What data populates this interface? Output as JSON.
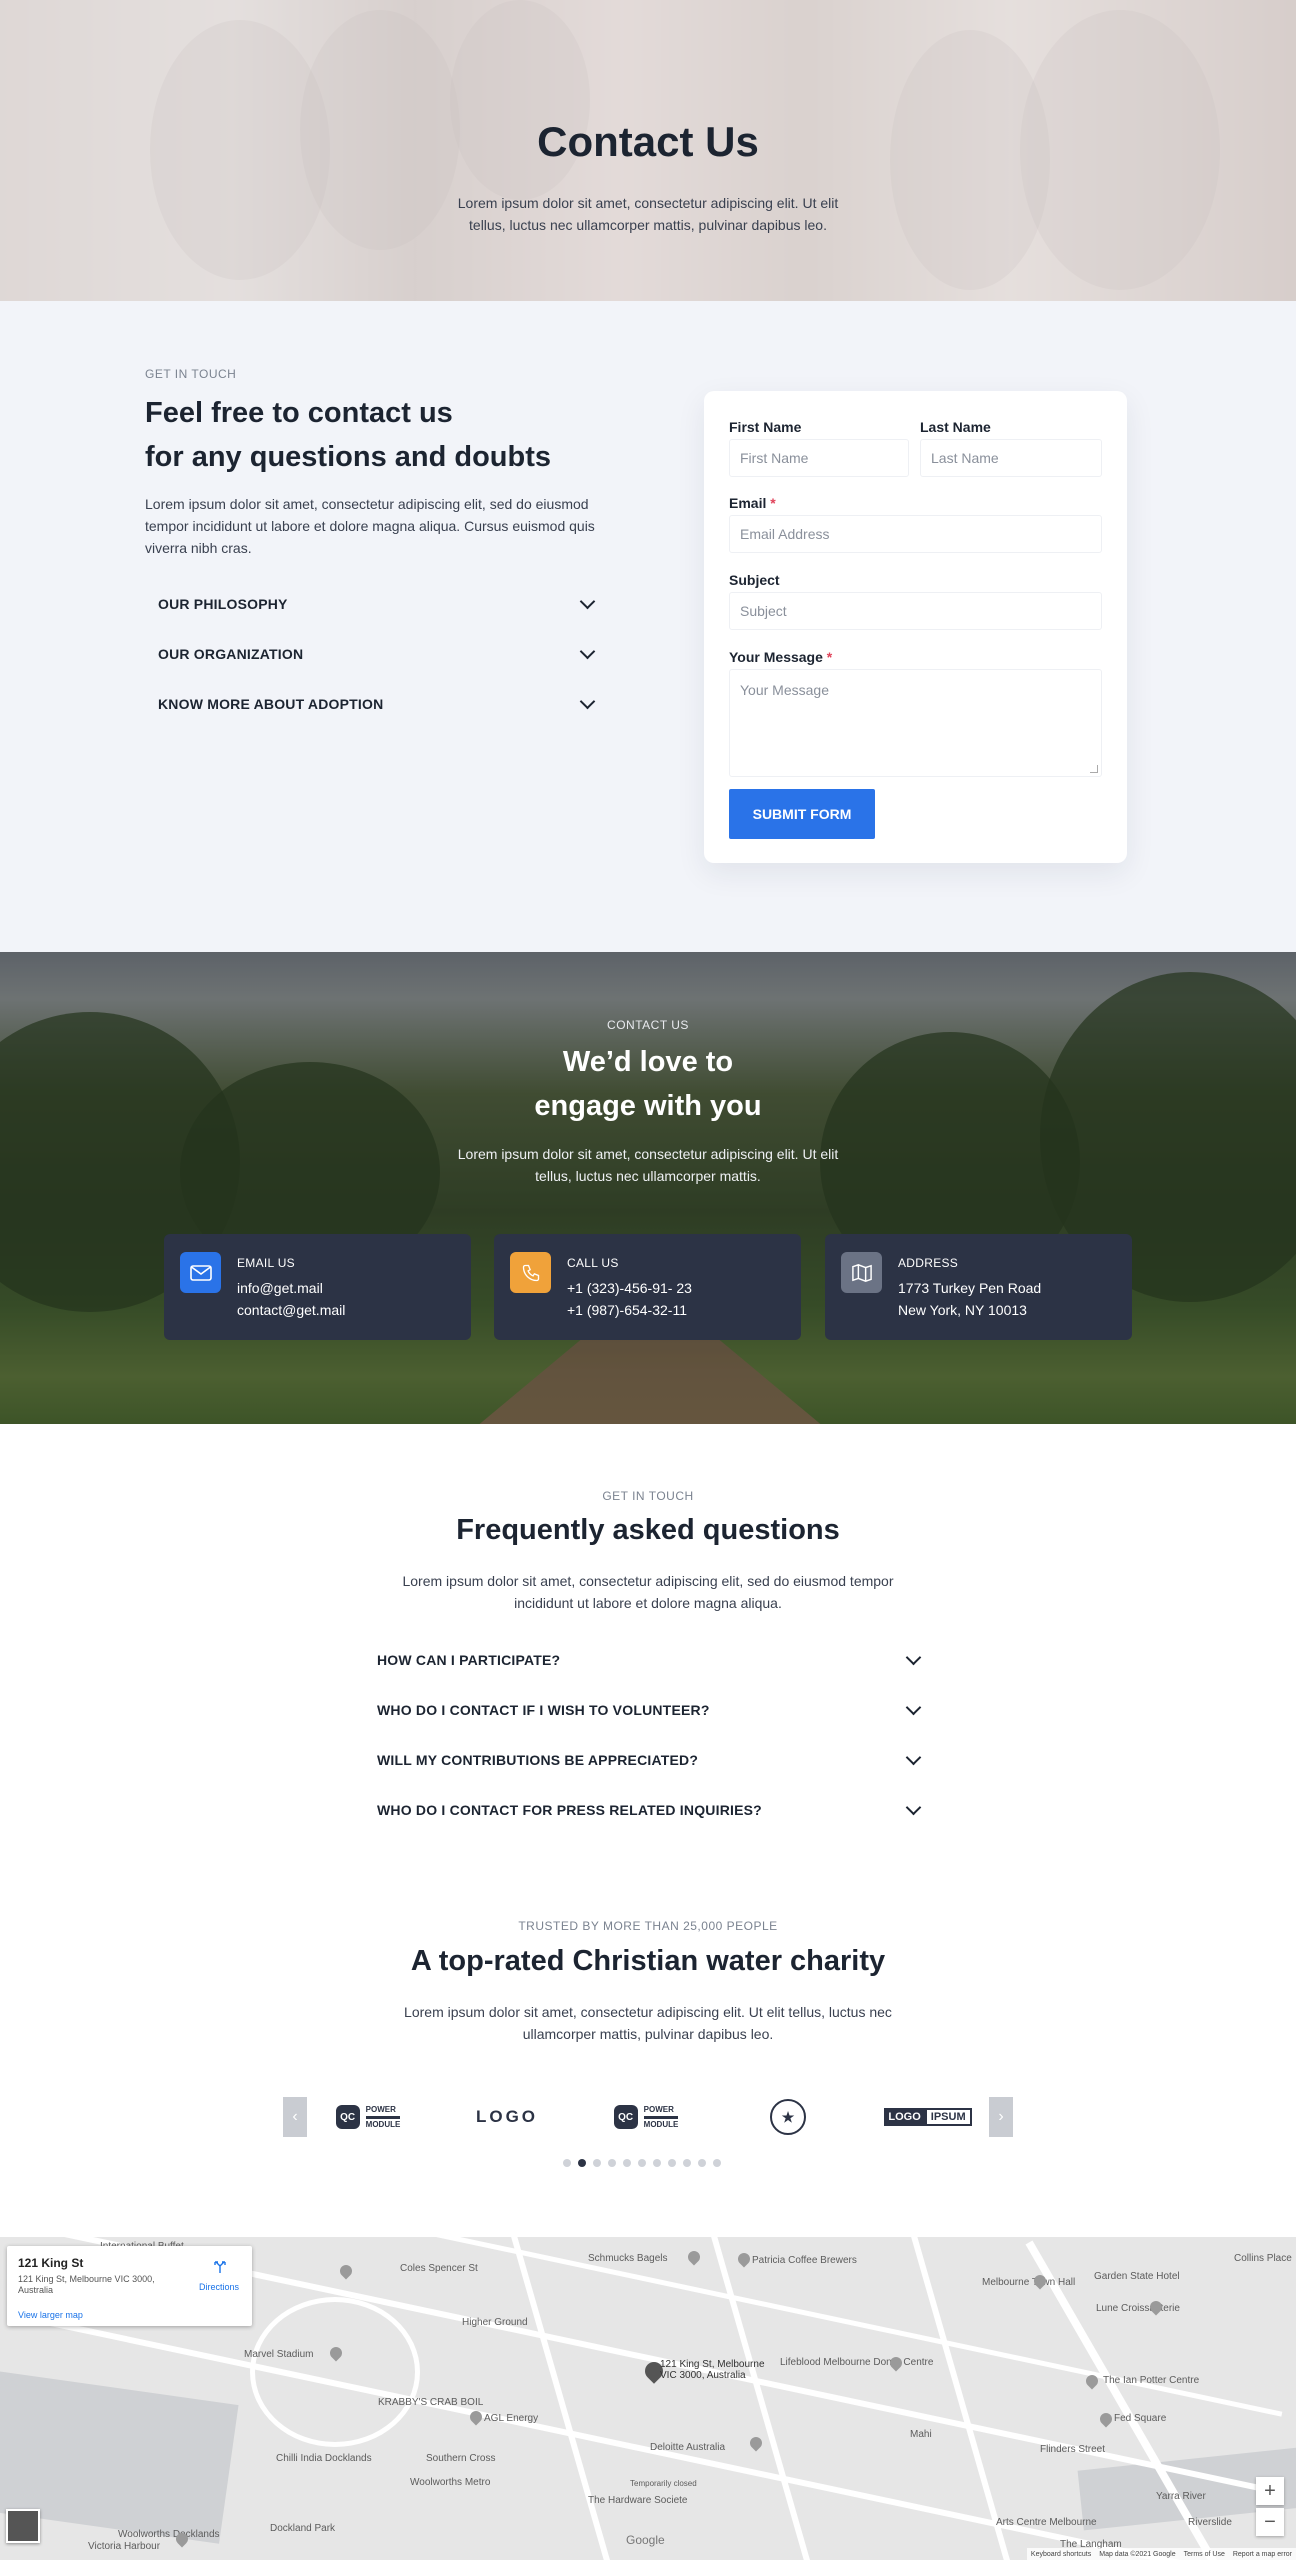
{
  "hero": {
    "title": "Contact Us",
    "subtitle": "Lorem ipsum dolor sit amet, consectetur adipiscing elit. Ut elit tellus, luctus nec ullamcorper mattis, pulvinar dapibus leo."
  },
  "contact": {
    "eyebrow": "GET IN TOUCH",
    "heading_line1": "Feel free to contact us",
    "heading_line2": "for any questions and doubts",
    "intro": "Lorem ipsum dolor sit amet, consectetur adipiscing elit, sed do eiusmod tempor incididunt ut labore et dolore magna aliqua. Cursus euismod quis viverra nibh cras.",
    "accordion": [
      "OUR PHILOSOPHY",
      "OUR ORGANIZATION",
      "KNOW MORE ABOUT ADOPTION"
    ]
  },
  "form": {
    "first_name_label": "First Name",
    "first_name_placeholder": "First Name",
    "last_name_label": "Last Name",
    "last_name_placeholder": "Last Name",
    "email_label": "Email",
    "email_placeholder": "Email Address",
    "subject_label": "Subject",
    "subject_placeholder": "Subject",
    "message_label": "Your Message",
    "message_placeholder": "Your Message",
    "required_mark": "*",
    "submit_label": "SUBMIT FORM",
    "accent_color": "#2a73e8"
  },
  "engage": {
    "eyebrow": "CONTACT US",
    "heading_line1": "We’d love to",
    "heading_line2": "engage with you",
    "intro": "Lorem ipsum dolor sit amet, consectetur adipiscing elit. Ut elit tellus, luctus nec ullamcorper mattis.",
    "cards": [
      {
        "icon": "envelope-icon",
        "color": "#2a73e8",
        "title": "EMAIL US",
        "line1": "info@get.mail",
        "line2": "contact@get.mail"
      },
      {
        "icon": "phone-icon",
        "color": "#f0a23a",
        "title": "CALL US",
        "line1": "+1 (323)-456-91- 23",
        "line2": "+1 (987)-654-32-11"
      },
      {
        "icon": "map-icon",
        "color": "#6b7385",
        "title": "ADDRESS",
        "line1": "1773 Turkey Pen Road",
        "line2": "New York, NY 10013"
      }
    ]
  },
  "faq": {
    "eyebrow": "GET IN TOUCH",
    "heading": "Frequently asked questions",
    "intro": "Lorem ipsum dolor sit amet, consectetur adipiscing elit, sed do eiusmod tempor incididunt ut labore et dolore magna aliqua.",
    "items": [
      "HOW CAN I PARTICIPATE?",
      "WHO DO I CONTACT IF I WISH TO VOLUNTEER?",
      "WILL MY CONTRIBUTIONS BE APPRECIATED?",
      "WHO DO I CONTACT FOR PRESS RELATED INQUIRIES?"
    ]
  },
  "trusted": {
    "eyebrow": "TRUSTED BY MORE THAN 25,000 PEOPLE",
    "heading": "A top-rated Christian water charity",
    "intro": "Lorem ipsum dolor sit amet, consectetur adipiscing elit. Ut elit tellus, luctus nec ullamcorper mattis, pulvinar dapibus leo.",
    "prev_arrow": "‹",
    "next_arrow": "›",
    "logos": [
      {
        "mark": "QC",
        "text1": "POWER",
        "text2": "MODULE"
      },
      {
        "text": "LOGO"
      },
      {
        "mark": "QC",
        "text1": "POWER",
        "text2": "MODULE"
      },
      {
        "text": "★"
      },
      {
        "text1": "LOGO",
        "text2": "IPSUM"
      }
    ],
    "dot_count": 11,
    "active_dot": 1
  },
  "map": {
    "place_title": "121 King St",
    "place_address": "121 King St, Melbourne VIC 3000, Australia",
    "directions_label": "Directions",
    "view_larger_label": "View larger map",
    "marker_label": "121 King St, Melbourne VIC 3000, Australia",
    "zoom_in": "+",
    "zoom_out": "−",
    "google_label": "Google",
    "attributions": [
      "Keyboard shortcuts",
      "Map data ©2021 Google",
      "Terms of Use",
      "Report a map error"
    ],
    "places": [
      "International Buffet",
      "Coles Spencer St",
      "Schmucks Bagels",
      "Patricia Coffee Brewers",
      "Melbourne Town Hall",
      "Garden State Hotel",
      "Collins Place",
      "Lune Croissanterie",
      "Higher Ground",
      "Marvel Stadium",
      "KRABBY'S CRAB BOIL",
      "AGL Energy",
      "Lifeblood Melbourne Donor Centre",
      "The Ian Potter Centre",
      "Chilli India Docklands",
      "Southern Cross",
      "Deloitte Australia",
      "Fed Square",
      "Flinders Street",
      "Woolworths Metro",
      "The Hardware Societe",
      "Yarra River",
      "Arts Centre Melbourne",
      "Riverslide",
      "Victoria Harbour",
      "Woolworths Docklands",
      "The Langham",
      "Dockland Park",
      "Mahi",
      "Temporarily closed"
    ]
  }
}
